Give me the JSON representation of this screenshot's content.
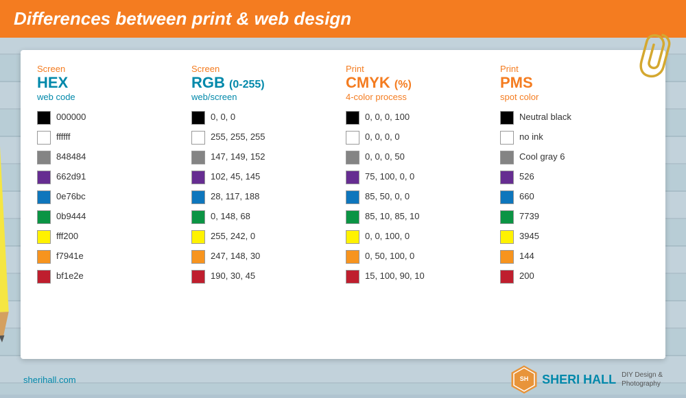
{
  "header": {
    "title": "Differences between print & web design"
  },
  "col_hex": {
    "label": "Screen",
    "main": "HEX",
    "sub": "web code"
  },
  "col_rgb": {
    "label": "Screen",
    "main": "RGB (0-255)",
    "sub": "web/screen"
  },
  "col_cmyk": {
    "label": "Print",
    "main": "CMYK (%)",
    "sub": "4-color process"
  },
  "col_pms": {
    "label": "Print",
    "main": "PMS",
    "sub": "spot color"
  },
  "rows": [
    {
      "swatch": "#000000",
      "border": true,
      "hex": "000000",
      "rgb": "0, 0, 0",
      "cmyk": "0, 0, 0, 100",
      "pms": "Neutral black"
    },
    {
      "swatch": "#ffffff",
      "border": true,
      "hex": "ffffff",
      "rgb": "255, 255, 255",
      "cmyk": "0, 0, 0, 0",
      "pms": "no ink"
    },
    {
      "swatch": "#848484",
      "border": false,
      "hex": "848484",
      "rgb": "147, 149, 152",
      "cmyk": "0, 0, 0, 50",
      "pms": "Cool gray 6"
    },
    {
      "swatch": "#662d91",
      "border": false,
      "hex": "662d91",
      "rgb": "102, 45, 145",
      "cmyk": "75, 100, 0, 0",
      "pms": "526"
    },
    {
      "swatch": "#0e76bc",
      "border": false,
      "hex": "0e76bc",
      "rgb": "28, 117, 188",
      "cmyk": "85, 50, 0, 0",
      "pms": "660"
    },
    {
      "swatch": "#0b9444",
      "border": false,
      "hex": "0b9444",
      "rgb": "0, 148, 68",
      "cmyk": "85, 10, 85, 10",
      "pms": "7739"
    },
    {
      "swatch": "#fff200",
      "border": false,
      "hex": "fff200",
      "rgb": "255, 242, 0",
      "cmyk": "0, 0, 100, 0",
      "pms": "3945"
    },
    {
      "swatch": "#f7941e",
      "border": false,
      "hex": "f7941e",
      "rgb": "247, 148, 30",
      "cmyk": "0, 50, 100, 0",
      "pms": "144"
    },
    {
      "swatch": "#bf1e2e",
      "border": false,
      "hex": "bf1e2e",
      "rgb": "190, 30, 45",
      "cmyk": "15, 100, 90, 10",
      "pms": "200"
    }
  ],
  "footer": {
    "url": "sherihall.com",
    "brand_name": "SHERI HALL",
    "brand_sub": "DIY Design &\nPhotography"
  }
}
